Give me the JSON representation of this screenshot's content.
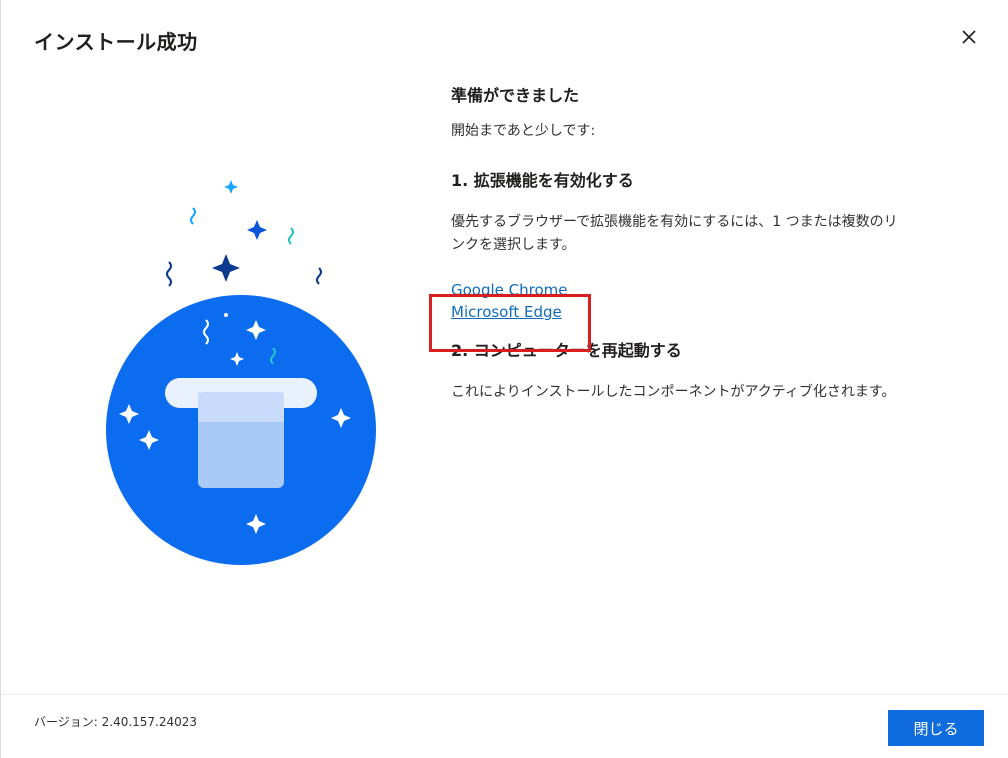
{
  "window": {
    "title": "インストール成功",
    "close_icon": "close-icon"
  },
  "content": {
    "ready_heading": "準備ができました",
    "ready_sub": "開始まであと少しです:",
    "step1_heading": "1. 拡張機能を有効化する",
    "step1_text_line1": "優先するブラウザーで拡張機能を有効にするには、1 つまたは複数のリ",
    "step1_text_line2": "ンクを選択します。",
    "links": [
      "Google Chrome",
      "Microsoft Edge"
    ],
    "step2_heading": "2. コンピューターを再起動する",
    "step2_text": "これによりインストールしたコンポーネントがアクティブ化されます。"
  },
  "footer": {
    "version": "バージョン: 2.40.157.24023",
    "close_button": "閉じる"
  },
  "colors": {
    "accent": "#0f6cde",
    "link": "#0f6cbd",
    "highlight_box": "#d81e1e",
    "circle": "#0b6cf0"
  },
  "illustration": {
    "icon": "magic-hat-illustration"
  }
}
